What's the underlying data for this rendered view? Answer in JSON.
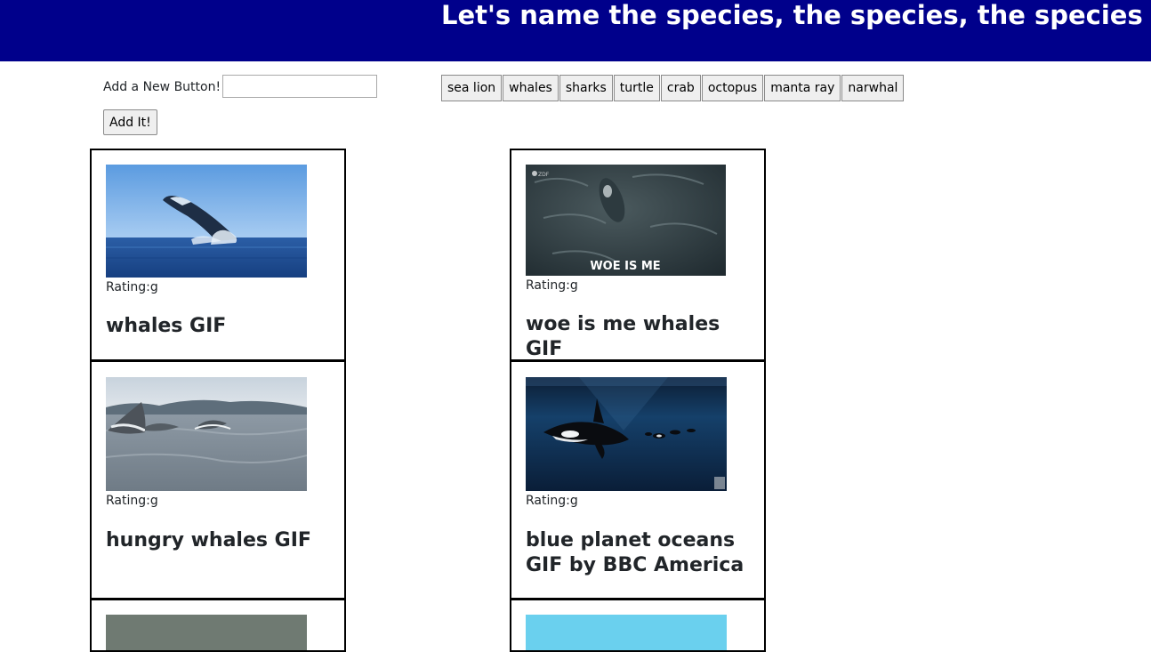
{
  "header": {
    "title": "Let's name the species, the species, the species"
  },
  "form": {
    "label": "Add a New Button!",
    "input_value": "",
    "submit_label": "Add It!"
  },
  "species_buttons": [
    "sea lion",
    "whales",
    "sharks",
    "turtle",
    "crab",
    "octopus",
    "manta ray",
    "narwhal"
  ],
  "gifs": [
    {
      "rating": "Rating:g",
      "title": "whales GIF",
      "overlay_text": ""
    },
    {
      "rating": "Rating:g",
      "title": "woe is me whales GIF",
      "overlay_text": "WOE IS ME"
    },
    {
      "rating": "Rating:g",
      "title": "hungry whales GIF",
      "overlay_text": ""
    },
    {
      "rating": "Rating:g",
      "title": "blue planet oceans GIF by BBC America",
      "overlay_text": ""
    }
  ],
  "colors": {
    "header_bg": "#00008b",
    "header_text": "#ffffff",
    "card_border": "#000000"
  }
}
